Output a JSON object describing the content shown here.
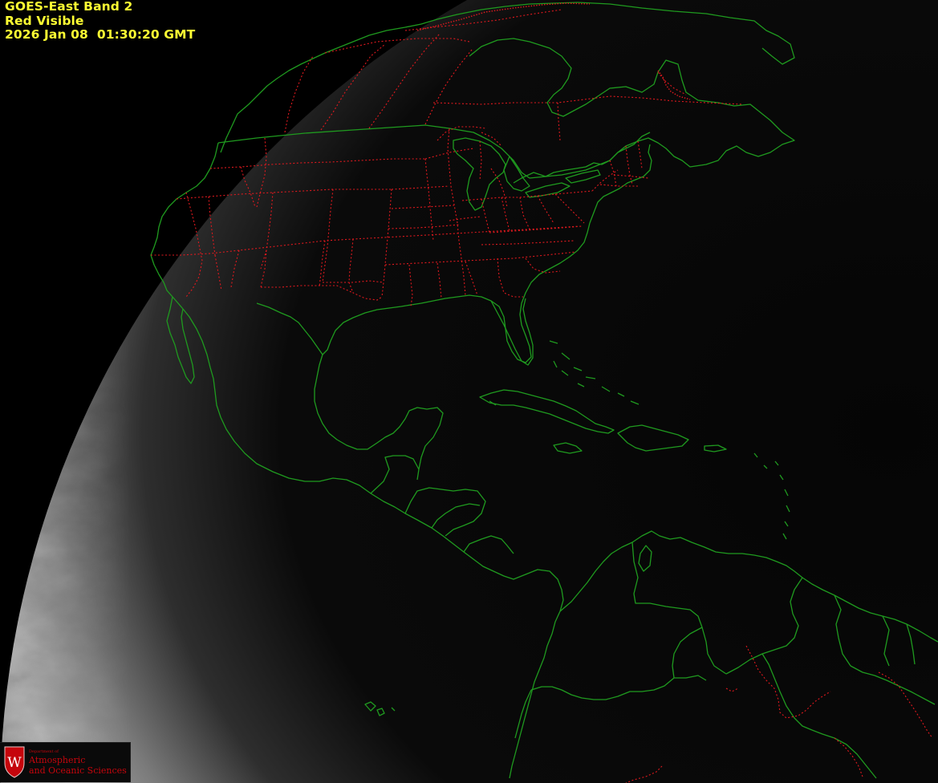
{
  "caption": {
    "satellite_band": "GOES-East Band 2",
    "channel": "Red Visible",
    "timestamp": "2026 Jan 08  01:30:20 GMT"
  },
  "logo": {
    "shield_letter": "W",
    "department": "Department of",
    "name_line1": "Atmospheric",
    "name_line2": "and Oceanic Sciences"
  },
  "colors": {
    "background": "#000000",
    "caption_text": "#ffff33",
    "coastline_and_national_borders": "#1f9a1f",
    "state_and_province_borders": "#e0191e",
    "logo_red": "#c5050c"
  },
  "map": {
    "projection": "geostationary full-disk view",
    "lit_area": "day-side cloud imagery on the western limb"
  }
}
